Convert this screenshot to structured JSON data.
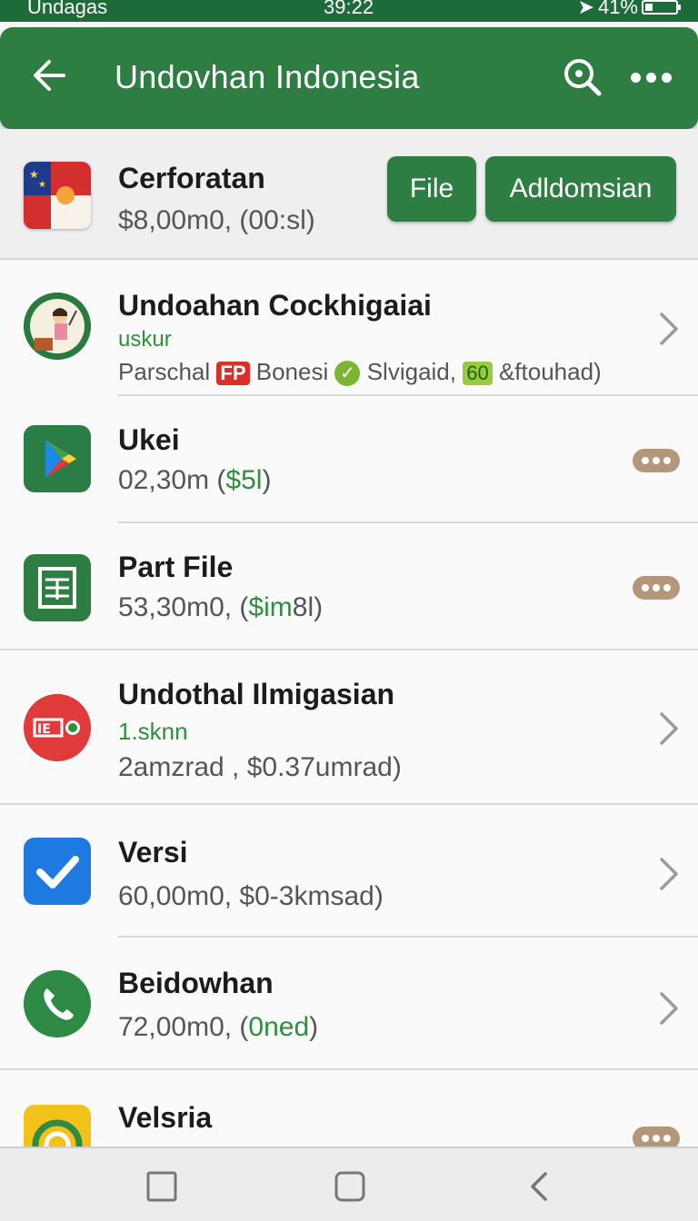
{
  "status": {
    "carrier": "Undagas",
    "time": "39:22",
    "battery": "41%"
  },
  "appbar": {
    "title": "Undovhan Indonesia"
  },
  "header": {
    "title": "Cerforatan",
    "subtitle": "$8,00m0, (00:sl)",
    "file_button": "File",
    "add_button": "Adldomsian"
  },
  "rows": [
    {
      "title": "Undoahan Cockhigaiai",
      "sub": "uskur",
      "meta_a": "Parschal",
      "tag_red": "FP",
      "meta_b": "Bonesi",
      "tag_check": "✓",
      "meta_c": "Slvigaid,",
      "tag_green": "60",
      "meta_d": "&ftouhad)"
    },
    {
      "title": "Ukei",
      "meta_a": "02,30m (",
      "meta_green": "$5l",
      "meta_b": ")"
    },
    {
      "title": "Part File",
      "meta_a": "53,30m0, (",
      "meta_green": "$im",
      "meta_b": "8l)"
    },
    {
      "title": "Undothal Ilmigasian",
      "sub": "1.sknn",
      "meta": "2amzrad ,  $0.37umrad)",
      "icon_text": "IE"
    },
    {
      "title": "Versi",
      "meta": "60,00m0,  $0-3kmsad)"
    },
    {
      "title": "Beidowhan",
      "meta_a": "72,00m0, (",
      "meta_green": "0ned",
      "meta_b": ")"
    },
    {
      "title": "Velsria"
    }
  ],
  "colors": {
    "primary": "#2e7d42",
    "accent_green": "#2f8f3c",
    "pill": "#b4977a"
  }
}
